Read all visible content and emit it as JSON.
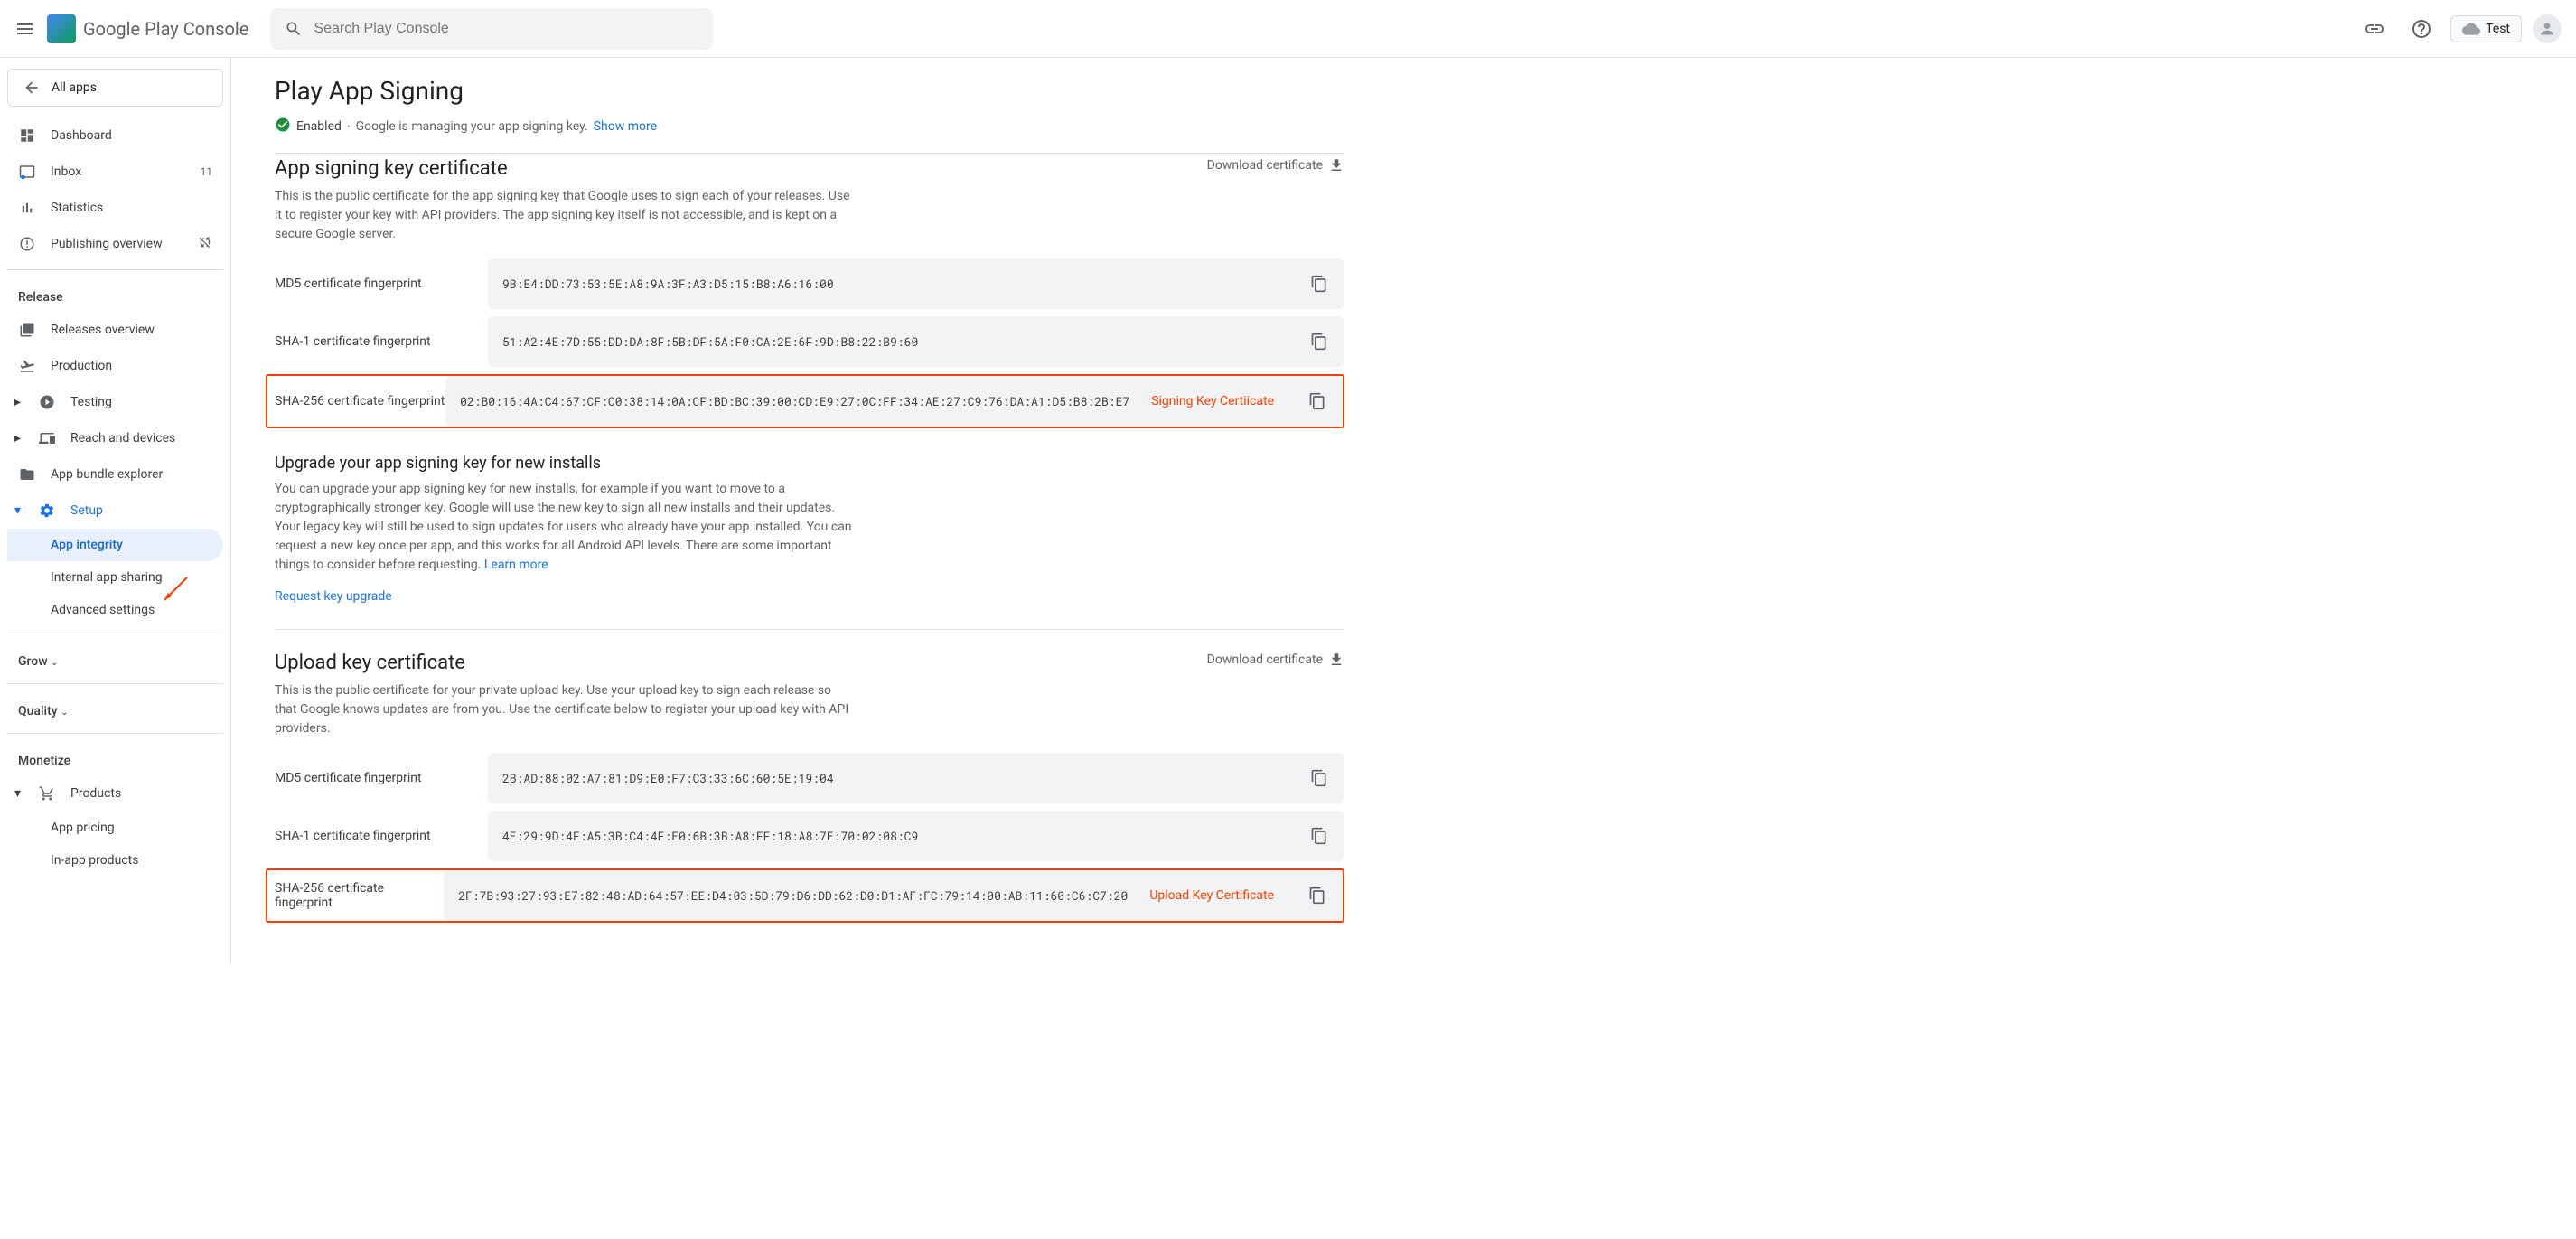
{
  "header": {
    "logo_text": "Google Play Console",
    "search_placeholder": "Search Play Console",
    "cloud_label": "Test"
  },
  "sidebar": {
    "all_apps": "All apps",
    "dashboard": "Dashboard",
    "inbox": "Inbox",
    "inbox_count": "11",
    "statistics": "Statistics",
    "publishing_overview": "Publishing overview",
    "release_section": "Release",
    "releases_overview": "Releases overview",
    "production": "Production",
    "testing": "Testing",
    "reach_devices": "Reach and devices",
    "app_bundle": "App bundle explorer",
    "setup": "Setup",
    "app_integrity": "App integrity",
    "internal_sharing": "Internal app sharing",
    "advanced_settings": "Advanced settings",
    "grow_section": "Grow",
    "quality_section": "Quality",
    "monetize_section": "Monetize",
    "products": "Products",
    "app_pricing": "App pricing",
    "inapp_products": "In-app products"
  },
  "page": {
    "title": "Play App Signing",
    "enabled_label": "Enabled",
    "managing_text": "Google is managing your app signing key.",
    "show_more": "Show more"
  },
  "signing": {
    "title": "App signing key certificate",
    "desc": "This is the public certificate for the app signing key that Google uses to sign each of your releases. Use it to register your key with API providers. The app signing key itself is not accessible, and is kept on a secure Google server.",
    "download": "Download certificate",
    "md5_label": "MD5 certificate fingerprint",
    "md5_value": "9B:E4:DD:73:53:5E:A8:9A:3F:A3:D5:15:B8:A6:16:00",
    "sha1_label": "SHA-1 certificate fingerprint",
    "sha1_value": "51:A2:4E:7D:55:DD:DA:8F:5B:DF:5A:F0:CA:2E:6F:9D:B8:22:B9:60",
    "sha256_label": "SHA-256 certificate fingerprint",
    "sha256_value": "02:B0:16:4A:C4:67:CF:C0:38:14:0A:CF:BD:BC:39:00:CD:E9:27:0C:FF:34:AE:27:C9:76:DA:A1:D5:B8:2B:E7",
    "annotation": "Signing Key Certiicate"
  },
  "upgrade": {
    "title": "Upgrade your app signing key for new installs",
    "desc": "You can upgrade your app signing key for new installs, for example if you want to move to a cryptographically stronger key. Google will use the new key to sign all new installs and their updates. Your legacy key will still be used to sign updates for users who already have your app installed. You can request a new key once per app, and this works for all Android API levels. There are some important things to consider before requesting.",
    "learn_more": "Learn more",
    "request": "Request key upgrade"
  },
  "upload": {
    "title": "Upload key certificate",
    "desc": "This is the public certificate for your private upload key. Use your upload key to sign each release so that Google knows updates are from you. Use the certificate below to register your upload key with API providers.",
    "download": "Download certificate",
    "md5_label": "MD5 certificate fingerprint",
    "md5_value": "2B:AD:88:02:A7:81:D9:E0:F7:C3:33:6C:60:5E:19:04",
    "sha1_label": "SHA-1 certificate fingerprint",
    "sha1_value": "4E:29:9D:4F:A5:3B:C4:4F:E0:6B:3B:A8:FF:18:A8:7E:70:02:08:C9",
    "sha256_label": "SHA-256 certificate fingerprint",
    "sha256_value": "2F:7B:93:27:93:E7:82:48:AD:64:57:EE:D4:03:5D:79:D6:DD:62:D0:D1:AF:FC:79:14:00:AB:11:60:C6:C7:20",
    "annotation": "Upload Key Certificate"
  }
}
